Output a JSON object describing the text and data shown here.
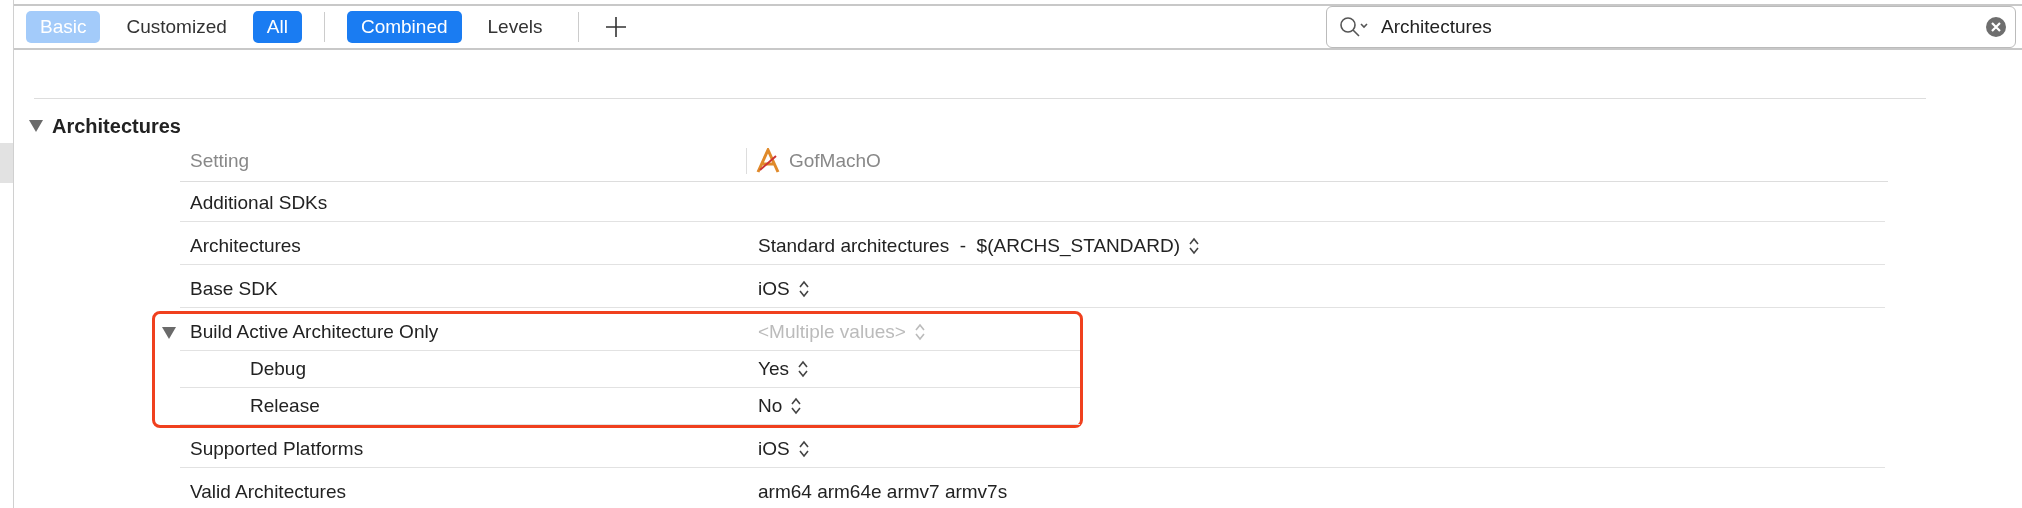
{
  "filter_groups": [
    {
      "items": [
        {
          "label": "Basic",
          "selected": true,
          "disabled": true
        },
        {
          "label": "Customized",
          "selected": false,
          "disabled": false
        },
        {
          "label": "All",
          "selected": true,
          "disabled": false
        }
      ]
    },
    {
      "items": [
        {
          "label": "Combined",
          "selected": true,
          "disabled": false
        },
        {
          "label": "Levels",
          "selected": false,
          "disabled": false
        }
      ]
    }
  ],
  "search": {
    "value": "Architectures"
  },
  "section": {
    "title": "Architectures",
    "expanded": true
  },
  "columns": {
    "setting": "Setting",
    "target": "GofMachO"
  },
  "rows": [
    {
      "name": "Additional SDKs",
      "highlighted": false
    },
    {
      "name": "Architectures",
      "value": "Standard architectures  -  $(ARCHS_STANDARD)",
      "stepper": true,
      "highlighted": false
    },
    {
      "name": "Base SDK",
      "value": "iOS",
      "stepper": true,
      "highlighted": false
    },
    {
      "name": "Build Active Architecture Only",
      "value": "<Multiple values>",
      "stepper": true,
      "muted": true,
      "highlighted": true,
      "expanded": true,
      "children": [
        {
          "name": "Debug",
          "value": "Yes",
          "stepper": true
        },
        {
          "name": "Release",
          "value": "No",
          "stepper": true
        }
      ]
    },
    {
      "name": "Supported Platforms",
      "value": "iOS",
      "stepper": true,
      "highlighted": false
    },
    {
      "name": "Valid Architectures",
      "value": "arm64 arm64e armv7 armv7s",
      "highlighted": false
    }
  ]
}
